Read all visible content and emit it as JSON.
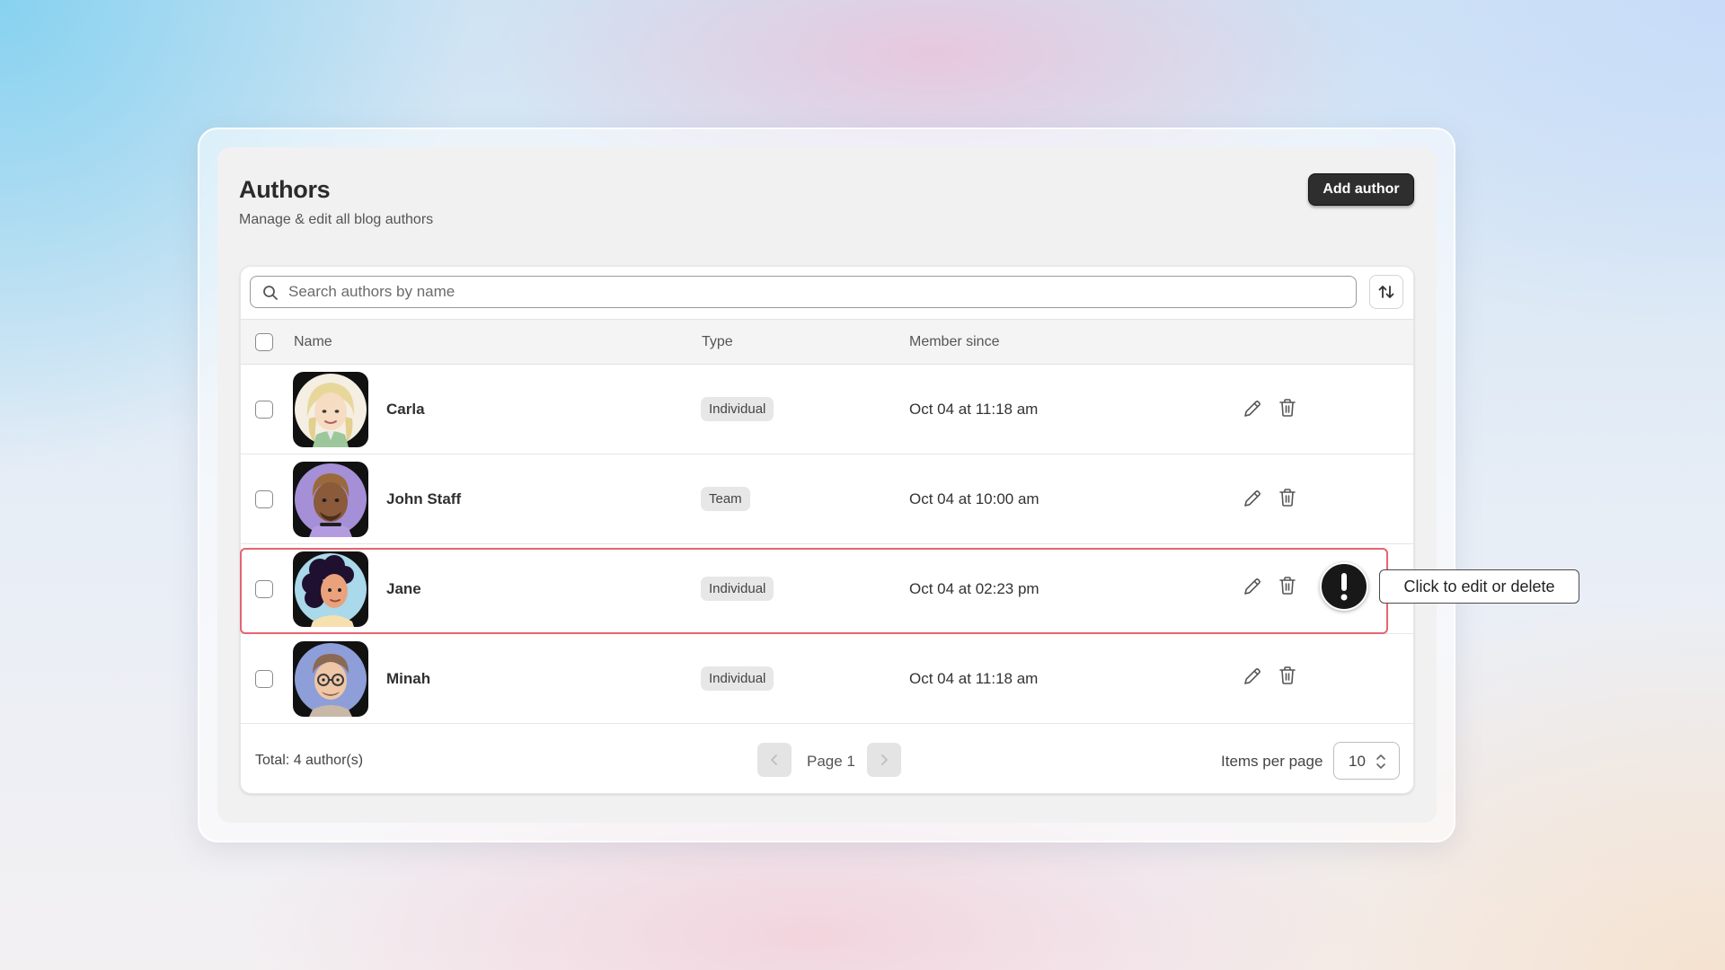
{
  "header": {
    "title": "Authors",
    "subtitle": "Manage & edit all blog authors",
    "add_button_label": "Add author"
  },
  "search": {
    "placeholder": "Search authors by name",
    "value": ""
  },
  "table": {
    "columns": [
      "Name",
      "Type",
      "Member since"
    ],
    "rows": [
      {
        "name": "Carla",
        "type": "Individual",
        "member_since": "Oct 04 at 11:18 am",
        "avatar": "avatar-blonde-woman"
      },
      {
        "name": "John Staff",
        "type": "Team",
        "member_since": "Oct 04 at 10:00 am",
        "avatar": "avatar-man-purple"
      },
      {
        "name": "Jane",
        "type": "Individual",
        "member_since": "Oct 04 at 02:23 pm",
        "avatar": "avatar-woman-curly-hair"
      },
      {
        "name": "Minah",
        "type": "Individual",
        "member_since": "Oct 04 at 11:18 am",
        "avatar": "avatar-man-glasses"
      }
    ],
    "highlighted_row": "Jane"
  },
  "tooltip": {
    "text": "Click to edit or delete",
    "icon": "exclamation-icon"
  },
  "footer": {
    "total_text": "Total: 4 author(s)",
    "page_label": "Page 1",
    "items_per_page_label": "Items per page",
    "items_per_page_value": "10"
  },
  "colors": {
    "primary_button": "#2e2e2e",
    "highlight_border": "#e56470",
    "badge_bg": "#e7e7e7"
  }
}
